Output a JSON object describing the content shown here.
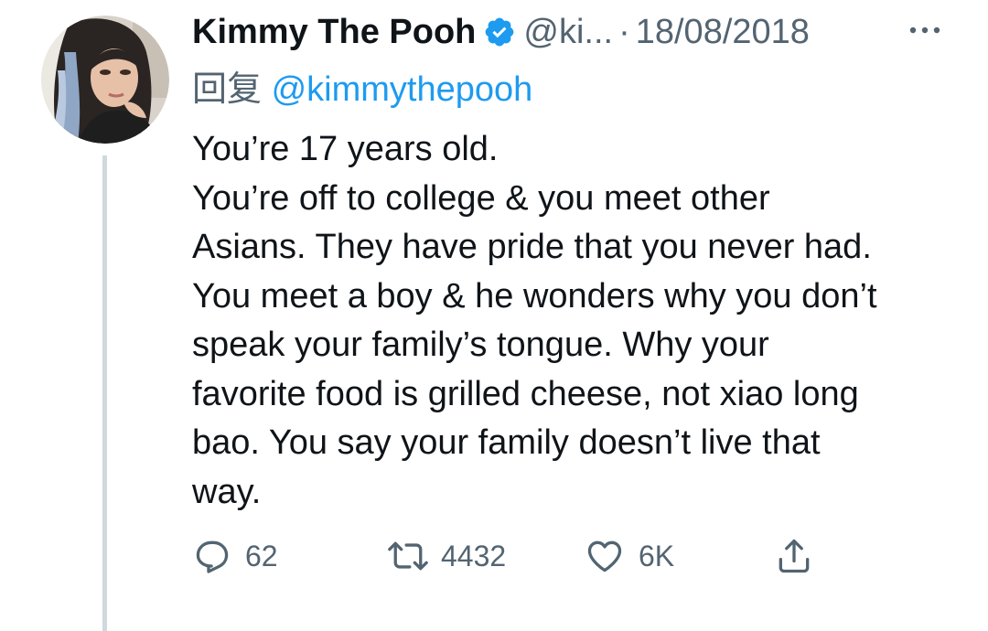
{
  "tweet": {
    "author_name": "Kimmy The Pooh",
    "author_handle": "@ki...",
    "separator": "·",
    "date": "18/08/2018",
    "reply_prefix": "回复",
    "reply_to": "@kimmythepooh",
    "body_lines": [
      "You’re 17 years old.",
      "You’re off to college & you meet other",
      "Asians. They have pride that you never had.",
      "You meet a boy & he wonders why you don’t",
      "speak your family’s tongue. Why your",
      "favorite food is grilled cheese, not xiao long",
      "bao. You say your family doesn’t live that",
      "way."
    ],
    "stats": {
      "replies": "62",
      "retweets": "4432",
      "likes": "6K"
    }
  },
  "icons": {
    "verified": "verified-badge-icon",
    "more": "more-options-icon",
    "reply": "reply-icon",
    "retweet": "retweet-icon",
    "like": "like-icon",
    "share": "share-icon"
  },
  "colors": {
    "text": "#0f1419",
    "secondary": "#536471",
    "link": "#1d9bf0",
    "verified": "#1d9bf0",
    "thread_line": "#cfd9de"
  }
}
